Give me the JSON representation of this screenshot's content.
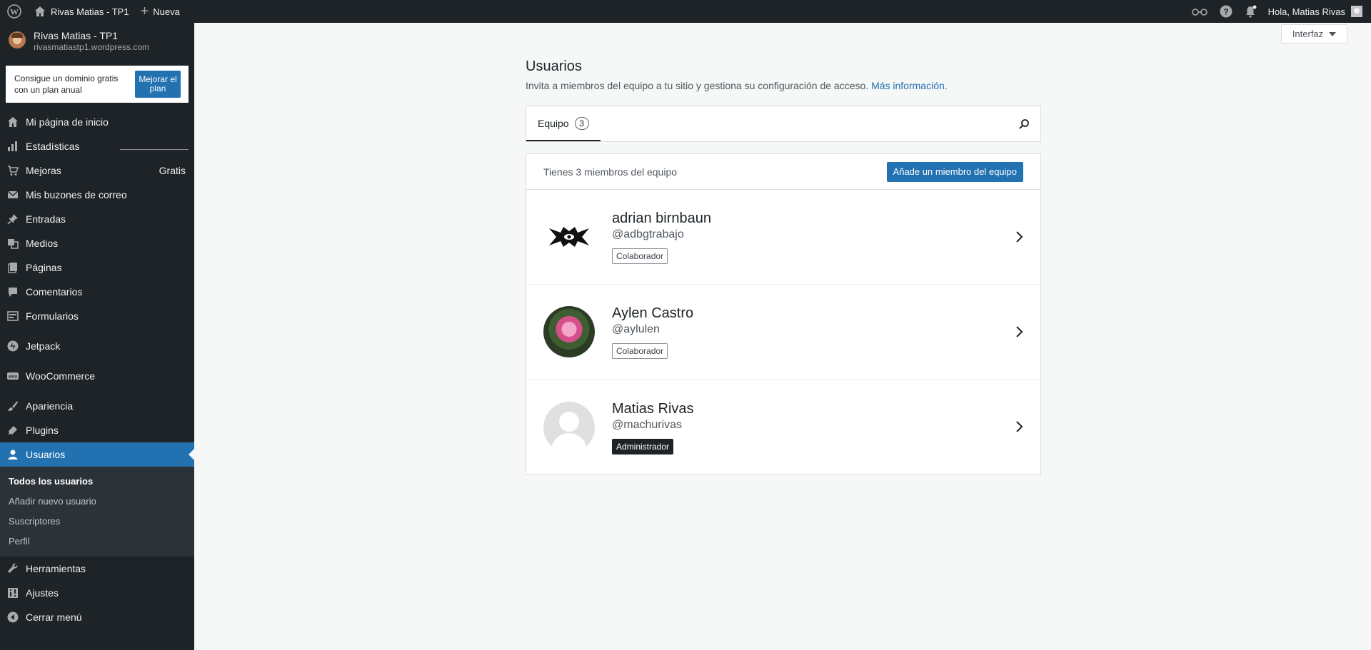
{
  "adminbar": {
    "site_title": "Rivas Matias - TP1",
    "new_label": "Nueva",
    "greeting": "Hola, Matias Rivas"
  },
  "sidebar": {
    "site_name": "Rivas Matias - TP1",
    "site_url": "rivasmatiastp1.wordpress.com",
    "promo_text": "Consigue un dominio gratis con un plan anual",
    "promo_button": "Mejorar el plan",
    "items": [
      {
        "label": "Mi página de inicio",
        "icon": "home-icon"
      },
      {
        "label": "Estadísticas",
        "icon": "stats-icon"
      },
      {
        "label": "Mejoras",
        "icon": "cart-icon",
        "badge": "Gratis"
      },
      {
        "label": "Mis buzones de correo",
        "icon": "mail-icon"
      },
      {
        "label": "Entradas",
        "icon": "pin-icon"
      },
      {
        "label": "Medios",
        "icon": "media-icon"
      },
      {
        "label": "Páginas",
        "icon": "pages-icon"
      },
      {
        "label": "Comentarios",
        "icon": "comments-icon"
      },
      {
        "label": "Formularios",
        "icon": "forms-icon"
      },
      {
        "label": "Jetpack",
        "icon": "jetpack-icon"
      },
      {
        "label": "WooCommerce",
        "icon": "woo-icon"
      },
      {
        "label": "Apariencia",
        "icon": "brush-icon"
      },
      {
        "label": "Plugins",
        "icon": "plugin-icon"
      },
      {
        "label": "Usuarios",
        "icon": "user-icon"
      },
      {
        "label": "Herramientas",
        "icon": "wrench-icon"
      },
      {
        "label": "Ajustes",
        "icon": "settings-icon"
      },
      {
        "label": "Cerrar menú",
        "icon": "collapse-icon"
      }
    ],
    "submenu": [
      "Todos los usuarios",
      "Añadir nuevo usuario",
      "Suscriptores",
      "Perfil"
    ]
  },
  "interfaz_label": "Interfaz",
  "main": {
    "title": "Usuarios",
    "subtitle": "Invita a miembros del equipo a tu sitio y gestiona su configuración de acceso.",
    "more_link": "Más información.",
    "tab_label": "Equipo",
    "tab_count": "3",
    "members_summary": "Tienes 3 miembros del equipo",
    "add_button": "Añade un miembro del equipo",
    "members": [
      {
        "name": "adrian birnbaun",
        "handle": "@adbgtrabajo",
        "role": "Colaborador"
      },
      {
        "name": "Aylen Castro",
        "handle": "@aylulen",
        "role": "Colaborador"
      },
      {
        "name": "Matias Rivas",
        "handle": "@machurivas",
        "role": "Administrador"
      }
    ]
  },
  "colors": {
    "accent": "#2271b1",
    "sidebar_bg": "#1d2327",
    "page_bg": "#f6f7f7"
  }
}
